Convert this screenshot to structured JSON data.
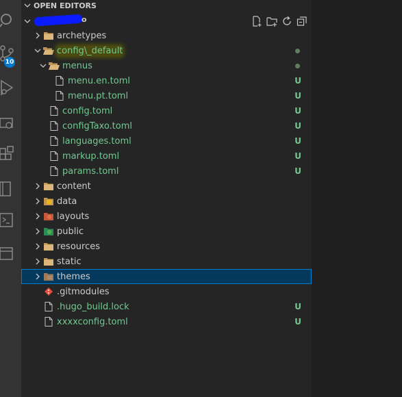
{
  "activity_bar": {
    "icons": [
      "search-icon",
      "source-control-icon",
      "run-debug-icon",
      "remote-explorer-icon",
      "extensions-icon",
      "notebook-icon",
      "terminal-icon",
      "panel-icon"
    ],
    "scm_badge": "10"
  },
  "explorer": {
    "open_editors_title": "OPEN EDITORS",
    "workspace_name": "",
    "actions": [
      "new-file-icon",
      "new-folder-icon",
      "refresh-icon",
      "collapse-all-icon"
    ]
  },
  "tree": [
    {
      "label": "archetypes",
      "depth": 0,
      "kind": "folder",
      "expanded": false,
      "icon": "folder-icon",
      "decoration": "",
      "untracked": false,
      "modified": false
    },
    {
      "label": "config\\_default",
      "depth": 0,
      "kind": "folder",
      "expanded": true,
      "icon": "folder-open-icon",
      "decoration": "",
      "untracked": true,
      "modified": true
    },
    {
      "label": "menus",
      "depth": 1,
      "kind": "folder",
      "expanded": true,
      "icon": "folder-open-icon",
      "decoration": "",
      "untracked": true,
      "modified": true
    },
    {
      "label": "menu.en.toml",
      "depth": 2,
      "kind": "file",
      "icon": "file-icon",
      "decoration": "U",
      "untracked": true
    },
    {
      "label": "menu.pt.toml",
      "depth": 2,
      "kind": "file",
      "icon": "file-icon",
      "decoration": "U",
      "untracked": true
    },
    {
      "label": "config.toml",
      "depth": 1,
      "kind": "file",
      "icon": "file-icon",
      "decoration": "U",
      "untracked": true
    },
    {
      "label": "configTaxo.toml",
      "depth": 1,
      "kind": "file",
      "icon": "file-icon",
      "decoration": "U",
      "untracked": true
    },
    {
      "label": "languages.toml",
      "depth": 1,
      "kind": "file",
      "icon": "file-icon",
      "decoration": "U",
      "untracked": true
    },
    {
      "label": "markup.toml",
      "depth": 1,
      "kind": "file",
      "icon": "file-icon",
      "decoration": "U",
      "untracked": true
    },
    {
      "label": "params.toml",
      "depth": 1,
      "kind": "file",
      "icon": "file-icon",
      "decoration": "U",
      "untracked": true
    },
    {
      "label": "content",
      "depth": 0,
      "kind": "folder",
      "expanded": false,
      "icon": "folder-icon",
      "decoration": ""
    },
    {
      "label": "data",
      "depth": 0,
      "kind": "folder",
      "expanded": false,
      "icon": "data-folder-icon",
      "decoration": ""
    },
    {
      "label": "layouts",
      "depth": 0,
      "kind": "folder",
      "expanded": false,
      "icon": "layouts-folder-icon",
      "decoration": ""
    },
    {
      "label": "public",
      "depth": 0,
      "kind": "folder",
      "expanded": false,
      "icon": "public-folder-icon",
      "decoration": ""
    },
    {
      "label": "resources",
      "depth": 0,
      "kind": "folder",
      "expanded": false,
      "icon": "folder-icon",
      "decoration": ""
    },
    {
      "label": "static",
      "depth": 0,
      "kind": "folder",
      "expanded": false,
      "icon": "folder-icon",
      "decoration": ""
    },
    {
      "label": "themes",
      "depth": 0,
      "kind": "folder",
      "expanded": false,
      "icon": "themes-folder-icon",
      "decoration": "",
      "selected": true
    },
    {
      "label": ".gitmodules",
      "depth": 0,
      "kind": "file",
      "icon": "git-icon",
      "decoration": ""
    },
    {
      "label": ".hugo_build.lock",
      "depth": 0,
      "kind": "file",
      "icon": "file-icon",
      "decoration": "U",
      "untracked": true
    },
    {
      "label": "xxxxconfig.toml",
      "depth": 0,
      "kind": "file",
      "icon": "file-icon",
      "decoration": "U",
      "untracked": true
    }
  ]
}
